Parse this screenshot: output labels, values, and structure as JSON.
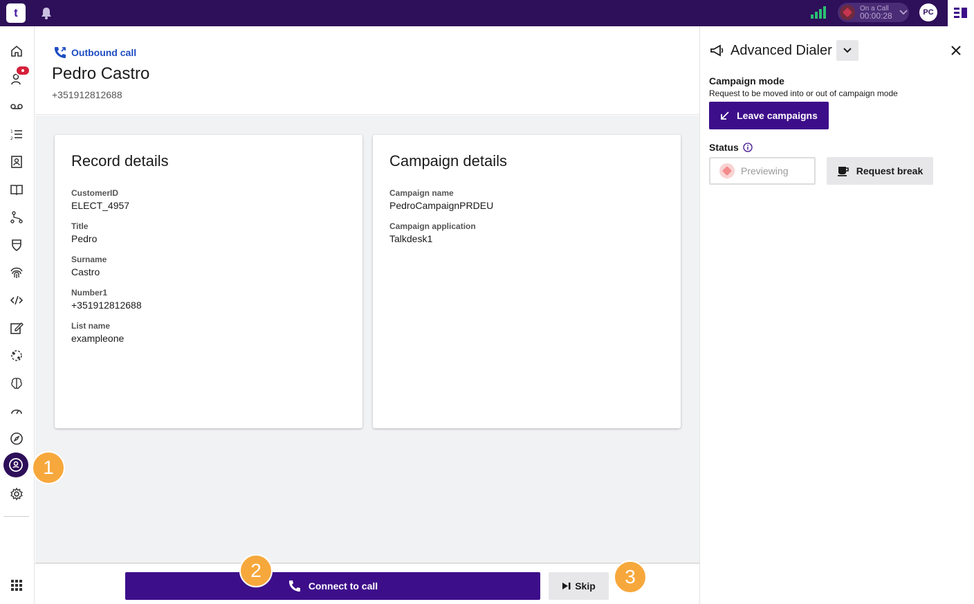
{
  "topbar": {
    "logo_text": "t",
    "call_status_label": "On a Call",
    "call_timer": "00:00:28",
    "user_initials": "PC"
  },
  "sidebar": {
    "icons": [
      "home-icon",
      "contacts-notification-icon",
      "voicemail-icon",
      "list-icon",
      "contact-card-icon",
      "book-icon",
      "flow-icon",
      "shield-icon",
      "fingerprint-icon",
      "code-icon",
      "edit-icon",
      "globe-icon",
      "brain-icon",
      "gauge-icon",
      "compass-icon",
      "campaign-agent-icon",
      "gear-icon",
      "apps-grid-icon"
    ]
  },
  "header": {
    "call_type": "Outbound call",
    "contact_name": "Pedro Castro",
    "contact_phone": "+351912812688"
  },
  "record_details": {
    "title": "Record details",
    "fields": [
      {
        "label": "CustomerID",
        "value": "ELECT_4957"
      },
      {
        "label": "Title",
        "value": "Pedro"
      },
      {
        "label": "Surname",
        "value": "Castro"
      },
      {
        "label": "Number1",
        "value": "+351912812688"
      },
      {
        "label": "List name",
        "value": "exampleone"
      }
    ]
  },
  "campaign_details": {
    "title": "Campaign details",
    "fields": [
      {
        "label": "Campaign name",
        "value": "PedroCampaignPRDEU"
      },
      {
        "label": "Campaign application",
        "value": "Talkdesk1"
      }
    ]
  },
  "bottom": {
    "connect_label": "Connect to call",
    "skip_label": "Skip"
  },
  "right_panel": {
    "title": "Advanced Dialer",
    "campaign_mode_heading": "Campaign mode",
    "campaign_mode_desc": "Request to be moved into or out of campaign mode",
    "leave_label": "Leave campaigns",
    "status_heading": "Status",
    "previewing_label": "Previewing",
    "break_label": "Request break"
  },
  "steps": [
    "1",
    "2",
    "3"
  ],
  "colors": {
    "topbar": "#2e0f59",
    "primary_button": "#3d0e8a",
    "link_blue": "#1d4cc2",
    "step_marker": "#f7a83c",
    "badge_red": "#d6203a"
  }
}
